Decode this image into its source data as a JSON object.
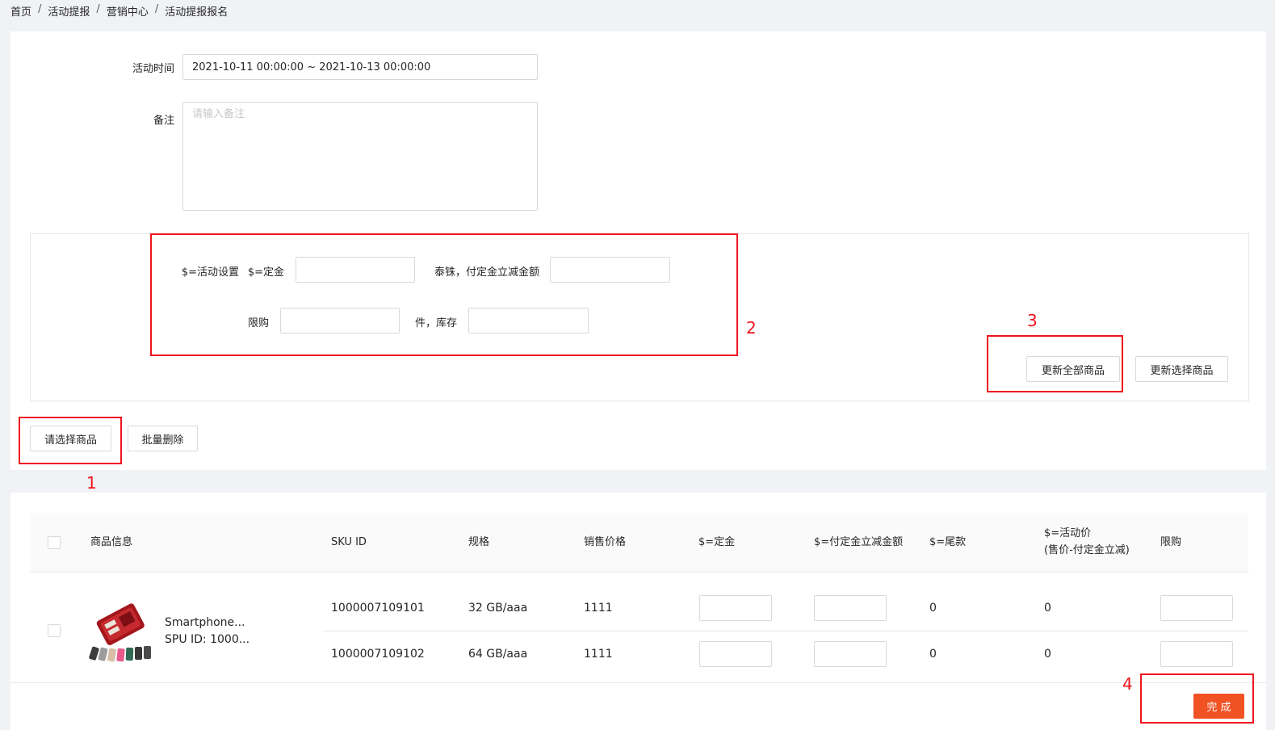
{
  "breadcrumb": [
    "首页",
    "活动提报",
    "营销中心",
    "活动提报报名"
  ],
  "form": {
    "time_label": "活动时间",
    "time_value": "2021-10-11 00:00:00 ~ 2021-10-13 00:00:00",
    "remark_label": "备注",
    "remark_placeholder": "请输入备注"
  },
  "settings": {
    "activity_setting_label": "$=活动设置",
    "deposit_label": "$=定金",
    "reduce_label": "泰铢，付定金立减金额",
    "limit_label": "限购",
    "stock_label": "件，库存"
  },
  "buttons": {
    "update_all": "更新全部商品",
    "update_selected": "更新选择商品",
    "select_products": "请选择商品",
    "batch_delete": "批量删除",
    "finish": "完 成"
  },
  "annotations": [
    "1",
    "2",
    "3",
    "4"
  ],
  "annotation_color": "#f0141e",
  "accent_color": "#f05223",
  "table": {
    "headers": [
      "商品信息",
      "SKU ID",
      "规格",
      "销售价格",
      "$=定金",
      "$=付定金立减金额",
      "$=尾款",
      "$=活动价",
      "(售价-付定金立减)",
      "限购"
    ],
    "product": {
      "name": "Smartphone...",
      "spu": "SPU ID: 1000..."
    },
    "rows": [
      {
        "sku": "1000007109101",
        "spec": "32 GB/aaa",
        "price": "1111",
        "balance": "0",
        "activity_price": "0"
      },
      {
        "sku": "1000007109102",
        "spec": "64 GB/aaa",
        "price": "1111",
        "balance": "0",
        "activity_price": "0"
      }
    ]
  }
}
